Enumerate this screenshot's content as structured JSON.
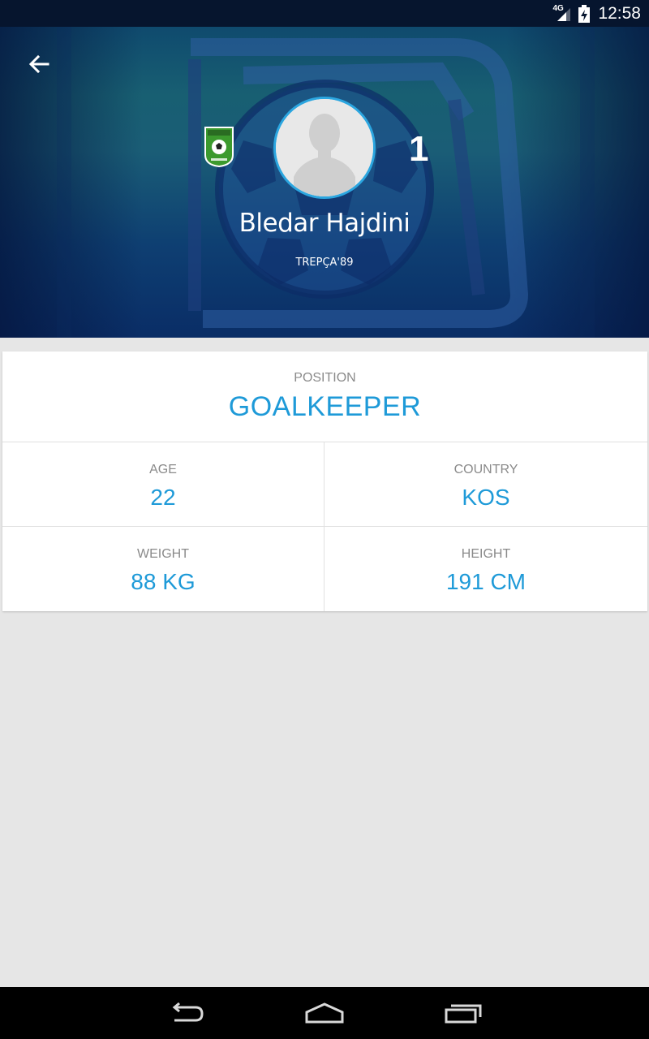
{
  "status_bar": {
    "network": "4G",
    "time": "12:58"
  },
  "header": {
    "back_icon": "arrow-left-icon",
    "jersey_number": "1",
    "player_name": "Bledar Hajdini",
    "team_name": "TREPÇA'89",
    "accent_color": "#2ba6e0"
  },
  "info": {
    "position": {
      "label": "POSITION",
      "value": "GOALKEEPER"
    },
    "age": {
      "label": "AGE",
      "value": "22"
    },
    "country": {
      "label": "COUNTRY",
      "value": "KOS"
    },
    "weight": {
      "label": "WEIGHT",
      "value": "88 KG"
    },
    "height": {
      "label": "HEIGHT",
      "value": "191 CM"
    },
    "value_color": "#1e9ad8"
  },
  "nav_bar": {
    "back_icon": "nav-back-icon",
    "home_icon": "nav-home-icon",
    "recents_icon": "nav-recents-icon"
  }
}
